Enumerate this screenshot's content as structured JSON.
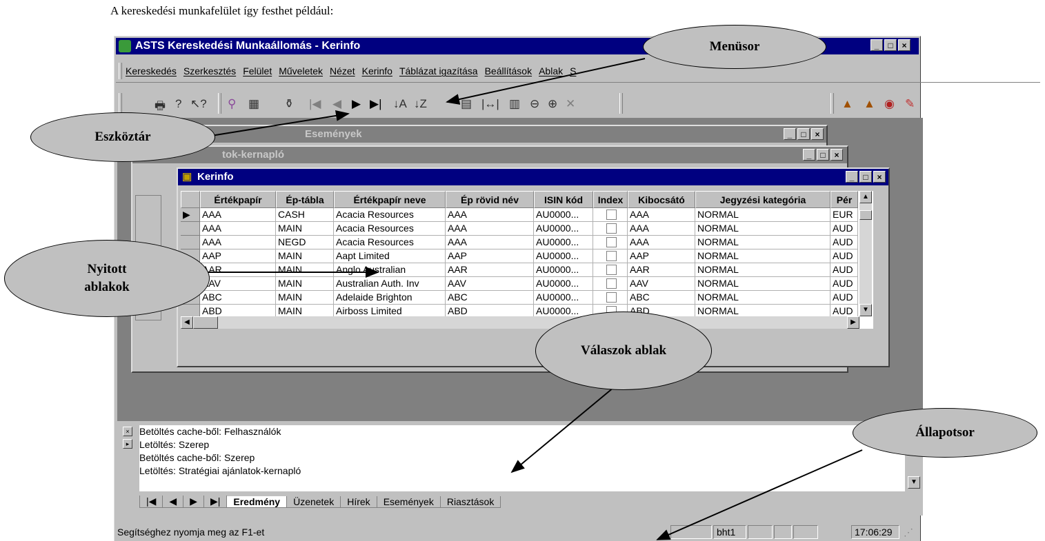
{
  "caption": "A kereskedési munkafelület így festhet például:",
  "window": {
    "title": "ASTS Kereskedési Munkaállomás - Kerinfo",
    "min": "_",
    "max": "□",
    "close": "×"
  },
  "menu": [
    "Kereskedés",
    "Szerkesztés",
    "Felület",
    "Műveletek",
    "Nézet",
    "Kerinfo",
    "Táblázat igazítása",
    "Beállítások",
    "Ablak",
    "S"
  ],
  "children": {
    "w1_title": "Események",
    "w2_title": "tok-kernapló",
    "w3_title": "Kerinfo"
  },
  "grid": {
    "headers": [
      "Értékpapír",
      "Ép-tábla",
      "Értékpapír neve",
      "Ép rövid név",
      "ISIN kód",
      "Index",
      "Kibocsátó",
      "Jegyzési kategória",
      "Pér"
    ],
    "rows": [
      [
        "AAA",
        "CASH",
        "Acacia Resources",
        "AAA",
        "AU0000...",
        "",
        "AAA",
        "NORMAL",
        "EUR"
      ],
      [
        "AAA",
        "MAIN",
        "Acacia Resources",
        "AAA",
        "AU0000...",
        "",
        "AAA",
        "NORMAL",
        "AUD"
      ],
      [
        "AAA",
        "NEGD",
        "Acacia Resources",
        "AAA",
        "AU0000...",
        "",
        "AAA",
        "NORMAL",
        "AUD"
      ],
      [
        "AAP",
        "MAIN",
        "Aapt Limited",
        "AAP",
        "AU0000...",
        "",
        "AAP",
        "NORMAL",
        "AUD"
      ],
      [
        "AAR",
        "MAIN",
        "Anglo Australian",
        "AAR",
        "AU0000...",
        "",
        "AAR",
        "NORMAL",
        "AUD"
      ],
      [
        "AAV",
        "MAIN",
        "Australian Auth. Inv",
        "AAV",
        "AU0000...",
        "",
        "AAV",
        "NORMAL",
        "AUD"
      ],
      [
        "ABC",
        "MAIN",
        "Adelaide Brighton",
        "ABC",
        "AU0000...",
        "",
        "ABC",
        "NORMAL",
        "AUD"
      ],
      [
        "ABD",
        "MAIN",
        "Airboss Limited",
        "ABD",
        "AU0000...",
        "",
        "ABD",
        "NORMAL",
        "AUD"
      ]
    ]
  },
  "results": {
    "lines": [
      "Betöltés cache-ből: Felhasználók",
      "Letöltés: Szerep",
      "Betöltés cache-ből: Szerep",
      "Letöltés: Stratégiai ajánlatok-kernapló"
    ],
    "tabs": [
      "Eredmény",
      "Üzenetek",
      "Hírek",
      "Események",
      "Riasztások"
    ]
  },
  "status": {
    "help": "Segítséghez nyomja meg az F1-et",
    "user": "bht1",
    "time": "17:06:29"
  },
  "callouts": {
    "menusor": "Menüsor",
    "eszkoztar": "Eszköztár",
    "nyitott": "Nyitott ablakok",
    "valaszok": "Válaszok ablak",
    "allapotsor": "Állapotsor"
  },
  "icons": {
    "toolbar": [
      "print-icon",
      "help-icon",
      "context-help-icon",
      "filter-icon",
      "first-icon",
      "prev-icon",
      "next-icon",
      "last-icon",
      "sort-asc-icon",
      "sort-desc-icon",
      "zoom-out-icon",
      "zoom-in-icon",
      "tool-icon"
    ]
  }
}
